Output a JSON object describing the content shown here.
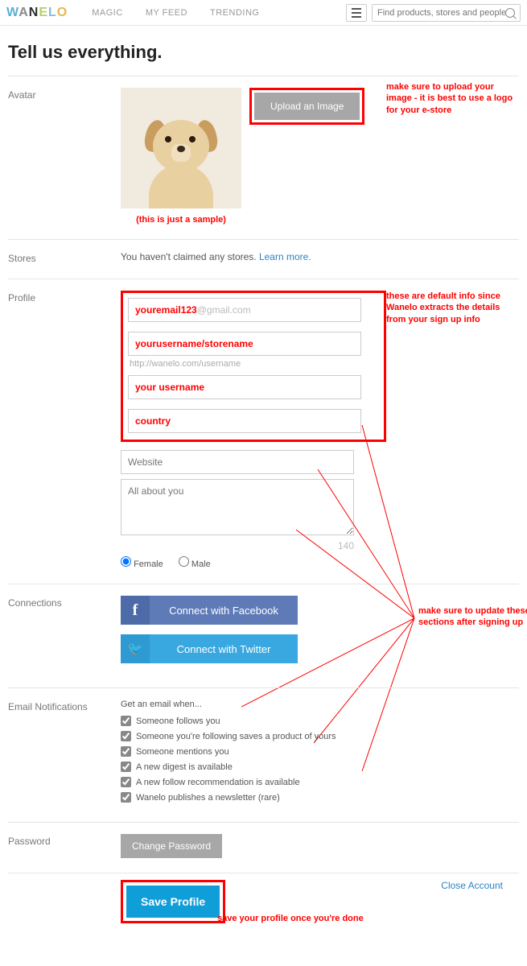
{
  "logo": {
    "w": "W",
    "a": "A",
    "n": "N",
    "e": "E",
    "l": "L",
    "o": "O"
  },
  "nav": {
    "magic": "MAGIC",
    "feed": "MY FEED",
    "trending": "TRENDING"
  },
  "search": {
    "placeholder": "Find products, stores and people"
  },
  "title": "Tell us everything.",
  "avatar": {
    "label": "Avatar",
    "upload": "Upload an Image",
    "sample": "(this is just a sample)"
  },
  "ann_upload": "make sure to upload your image - it is best to use a logo for your e-store",
  "stores": {
    "label": "Stores",
    "text": "You haven't claimed any stores. ",
    "learn": "Learn more."
  },
  "profile": {
    "label": "Profile",
    "email_pre": "youremail123",
    "email_suf": "@gmail.com",
    "username_store": "yourusername/storename",
    "url_hint": "http://wanelo.com/username",
    "username": "your username",
    "country": "country",
    "website_ph": "Website",
    "about_ph": "All about you",
    "char_count": "140",
    "female": "Female",
    "male": "Male"
  },
  "ann_defaults": "these are default info since Wanelo extracts the details from your sign up info",
  "connections": {
    "label": "Connections",
    "fb": "Connect with Facebook",
    "tw": "Connect with Twitter"
  },
  "ann_update": "make sure to update these sections after signing up",
  "notif": {
    "label": "Email Notifications",
    "intro": "Get an email when...",
    "items": [
      "Someone follows you",
      "Someone you're following saves a product of yours",
      "Someone mentions you",
      "A new digest is available",
      "A new follow recommendation is available",
      "Wanelo publishes a newsletter (rare)"
    ]
  },
  "password": {
    "label": "Password",
    "change": "Change Password"
  },
  "close_account": "Close Account",
  "save": "Save Profile",
  "ann_save": "save your profile once you're done"
}
